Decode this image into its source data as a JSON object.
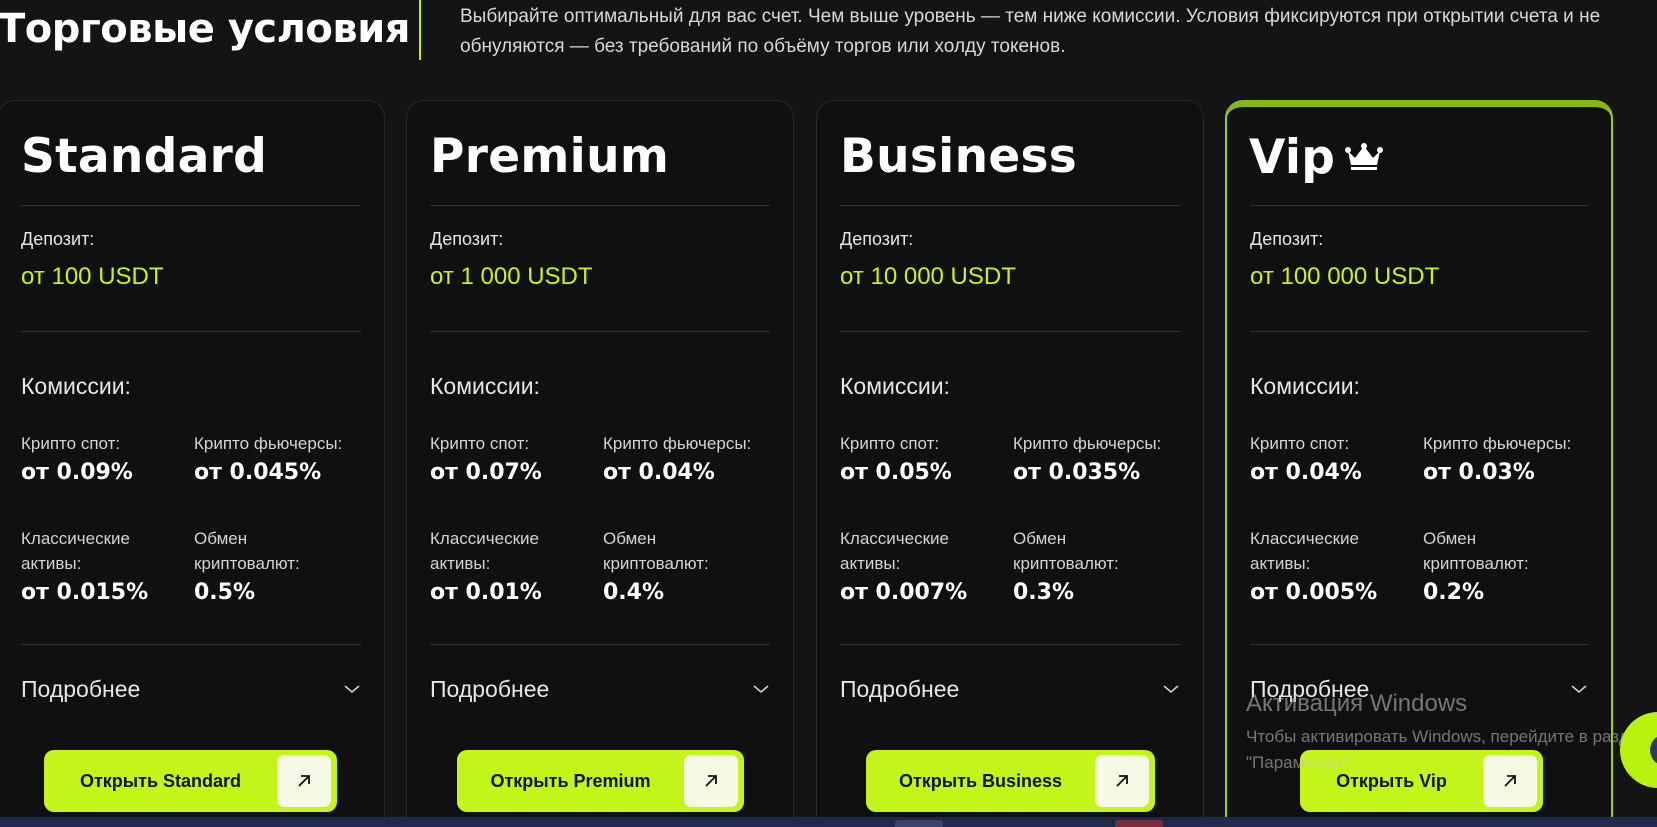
{
  "header": {
    "title": "Торговые условия",
    "intro": "Выбирайте оптимальный для вас счет. Чем выше уровень — тем ниже комиссии. Условия фиксируются при открытии счета и не обнуляются — без требований по объёму торгов или холду токенов."
  },
  "labels": {
    "deposit": "Депозит:",
    "fees": "Комиссии:",
    "crypto_spot": "Крипто спот:",
    "crypto_futures": "Крипто фьючерсы:",
    "classic_assets": "Классические активы:",
    "crypto_exchange": "Обмен криптовалют:",
    "details": "Подробнее"
  },
  "plans": [
    {
      "name": "Standard",
      "deposit": "от 100 USDT",
      "crypto_spot": "от 0.09%",
      "crypto_futures": "от 0.045%",
      "classic_assets": "от 0.015%",
      "crypto_exchange": "0.5%",
      "button": "Открыть Standard"
    },
    {
      "name": "Premium",
      "deposit": "от 1 000 USDT",
      "crypto_spot": "от 0.07%",
      "crypto_futures": "от 0.04%",
      "classic_assets": "от 0.01%",
      "crypto_exchange": "0.4%",
      "button": "Открыть Premium"
    },
    {
      "name": "Business",
      "deposit": "от 10 000 USDT",
      "crypto_spot": "от 0.05%",
      "crypto_futures": "от 0.035%",
      "classic_assets": "от 0.007%",
      "crypto_exchange": "0.3%",
      "button": "Открыть Business"
    },
    {
      "name": "Vip",
      "deposit": "от 100 000 USDT",
      "crypto_spot": "от 0.04%",
      "crypto_futures": "от 0.03%",
      "classic_assets": "от 0.005%",
      "crypto_exchange": "0.2%",
      "button": "Открыть Vip",
      "icon": "crown-icon"
    }
  ],
  "watermark": {
    "title": "Активация Windows",
    "text": "Чтобы активировать Windows, перейдите в раздел \"Параметры\"."
  },
  "colors": {
    "accent": "#c3f51b",
    "background": "#141414",
    "card": "#101010",
    "vip_border": "#9ad10b"
  }
}
